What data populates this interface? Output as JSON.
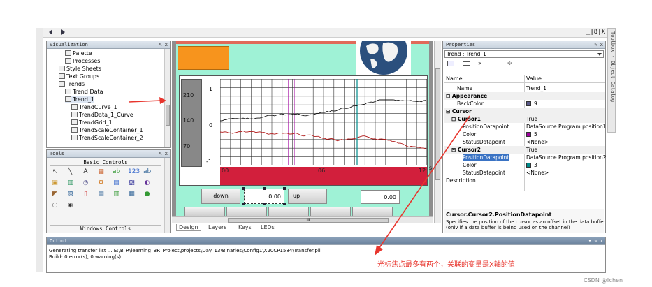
{
  "toolbar": {
    "back_icon": "triangle-left",
    "forward_icon": "triangle-right",
    "win_controls": "_|8|X"
  },
  "visualization": {
    "title": "Visualization",
    "controls": "✎ x",
    "tree": [
      {
        "label": "Palette",
        "level": 2
      },
      {
        "label": "Processes",
        "level": 2
      },
      {
        "label": "Style Sheets",
        "level": 1
      },
      {
        "label": "Text Groups",
        "level": 1
      },
      {
        "label": "Trends",
        "level": 1
      },
      {
        "label": "Trend Data",
        "level": 2
      },
      {
        "label": "Trend_1",
        "level": 2
      },
      {
        "label": "TrendCurve_1",
        "level": 3
      },
      {
        "label": "TrendData_1_Curve",
        "level": 3
      },
      {
        "label": "TrendGrid_1",
        "level": 3
      },
      {
        "label": "TrendScaleContainer_1",
        "level": 3
      },
      {
        "label": "TrendScaleContainer_2",
        "level": 3
      }
    ]
  },
  "tools": {
    "title": "Tools",
    "controls": "✎ x",
    "basic_title": "Basic Controls",
    "windows_title": "Windows Controls"
  },
  "trend": {
    "y_ticks_outer": [
      "210",
      "140",
      "70"
    ],
    "y_ticks_inner": [
      "1",
      "0",
      "-1"
    ],
    "x_ticks": [
      "00",
      "06",
      "12"
    ],
    "s_label": "s",
    "down_label": "down",
    "up_label": "up",
    "value1": "0.00",
    "value2": "0.00",
    "hscroll_mark": "III"
  },
  "bottom_tabs": [
    "Design",
    "Layers",
    "Keys",
    "LEDs"
  ],
  "properties": {
    "title": "Properties",
    "controls": "✎ x",
    "selector": "Trend : Trend_1",
    "col_name": "Name",
    "col_value": "Value",
    "rows": [
      {
        "k": "Name",
        "v": "Trend_1",
        "indent": 2,
        "group": false
      },
      {
        "k": "Appearance",
        "v": "",
        "indent": 0,
        "group": true,
        "sign": "⊟"
      },
      {
        "k": "BackColor",
        "v": "9",
        "indent": 2,
        "group": false,
        "color": "#5a5a8a"
      },
      {
        "k": "Cursor",
        "v": "",
        "indent": 0,
        "group": true,
        "sign": "⊟"
      },
      {
        "k": "Cursor1",
        "v": "True",
        "indent": 1,
        "group": true,
        "sign": "⊟"
      },
      {
        "k": "PositionDatapoint",
        "v": "DataSource.Program.position1",
        "indent": 3,
        "group": false
      },
      {
        "k": "Color",
        "v": "5",
        "indent": 3,
        "group": false,
        "color": "#a000a0"
      },
      {
        "k": "StatusDatapoint",
        "v": "<None>",
        "indent": 3,
        "group": false
      },
      {
        "k": "Cursor2",
        "v": "True",
        "indent": 1,
        "group": true,
        "sign": "⊟"
      },
      {
        "k": "PositionDatapoint",
        "v": "DataSource.Program.position2",
        "indent": 3,
        "group": false,
        "selected": true
      },
      {
        "k": "Color",
        "v": "3",
        "indent": 3,
        "group": false,
        "color": "#008b8b"
      },
      {
        "k": "StatusDatapoint",
        "v": "<None>",
        "indent": 3,
        "group": false
      },
      {
        "k": "Description",
        "v": "",
        "indent": 0,
        "group": false
      }
    ],
    "desc_title": "Cursor.Cursor2.PositionDatapoint",
    "desc_line1": "Specifies the position of the cursor as an offset in the data buffer",
    "desc_line2": "(only if a data buffer is being used on the channel)"
  },
  "toolbox_side": "Toolbox - Object Catalog",
  "output": {
    "title": "Output",
    "controls": "▾ ✎ x",
    "line1": "Generating transfer list ... E:\\B_R\\learning_BR_Project\\projects\\Day_13\\Binaries\\Config1\\X20CP1584\\Transfer.pil",
    "line2": "Build: 0 error(s), 0 warning(s)"
  },
  "annotation": "光标焦点最多有两个，关联的变量是X轴的值",
  "watermark": "CSDN @!chen",
  "colors": {
    "accent_red": "#e8352d",
    "canvas_green": "#9ff2d6",
    "scale_red": "#d21f3c",
    "panel_gray": "#888888"
  }
}
